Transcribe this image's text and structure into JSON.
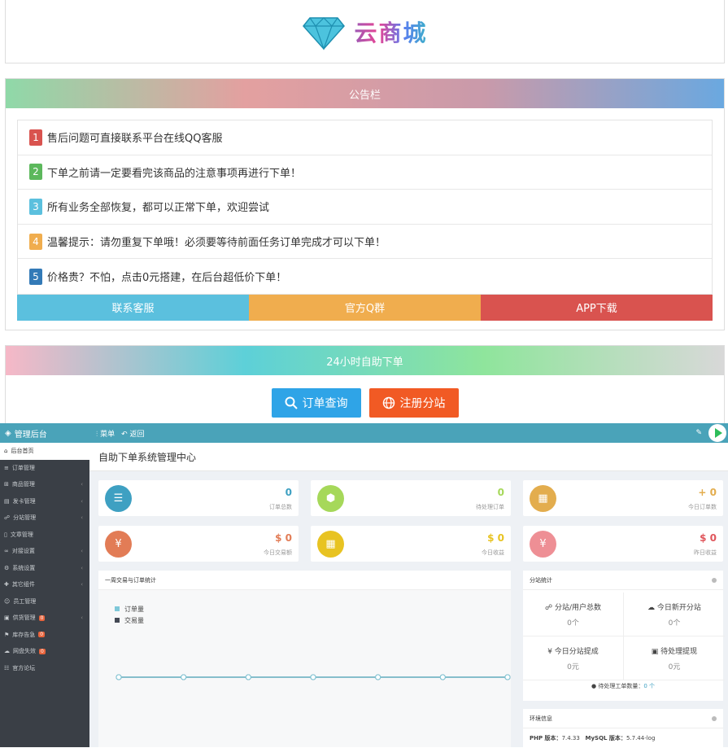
{
  "site": {
    "name": "云商城"
  },
  "notice": {
    "title": "公告栏",
    "items": [
      {
        "num": "1",
        "text": "售后问题可直接联系平台在线QQ客服",
        "color": "#d9534f"
      },
      {
        "num": "2",
        "text": "下单之前请一定要看完该商品的注意事项再进行下单！",
        "color": "#5cb85c"
      },
      {
        "num": "3",
        "text": "所有业务全部恢复，都可以正常下单，欢迎尝试",
        "color": "#5bc0de"
      },
      {
        "num": "4",
        "text": "温馨提示：请勿重复下单哦！必须要等待前面任务订单完成才可以下单！",
        "color": "#f0ad4e"
      },
      {
        "num": "5",
        "text": "价格贵？不怕，点击0元搭建，在后台超低价下单！",
        "color": "#337ab7"
      }
    ],
    "buttons": [
      {
        "label": "联系客服",
        "color": "#5bc0de"
      },
      {
        "label": "官方Q群",
        "color": "#f0ad4e"
      },
      {
        "label": "APP下载",
        "color": "#d9534f"
      }
    ]
  },
  "selfservice": {
    "title": "24小时自助下单",
    "query_label": "订单查询",
    "register_label": "注册分站"
  },
  "admin": {
    "brand": "管理后台",
    "menu_label": "菜单",
    "back_label": "返回",
    "page_title": "自助下单系统管理中心",
    "sidebar": [
      {
        "label": "后台首页",
        "icon": "home-icon",
        "active": true
      },
      {
        "label": "订单管理",
        "icon": "list-icon"
      },
      {
        "label": "商品管理",
        "icon": "cart-icon",
        "arrow": true
      },
      {
        "label": "发卡管理",
        "icon": "card-icon",
        "arrow": true
      },
      {
        "label": "分站管理",
        "icon": "sitemap-icon",
        "arrow": true
      },
      {
        "label": "文章管理",
        "icon": "doc-icon"
      },
      {
        "label": "对接设置",
        "icon": "link-icon",
        "arrow": true
      },
      {
        "label": "系统设置",
        "icon": "gear-icon",
        "arrow": true
      },
      {
        "label": "其它组件",
        "icon": "puzzle-icon",
        "arrow": true
      },
      {
        "label": "员工管理",
        "icon": "user-icon"
      },
      {
        "label": "供货管理",
        "icon": "truck-icon",
        "badge": "0",
        "arrow": true
      },
      {
        "label": "库存告急",
        "icon": "alert-icon",
        "badge": "0"
      },
      {
        "label": "网盘失效",
        "icon": "cloud-icon",
        "badge": "0"
      },
      {
        "label": "官方论坛",
        "icon": "forum-icon"
      }
    ],
    "stats": [
      {
        "value": "0",
        "label": "订单总数",
        "color": "#3ea0c2",
        "valcolor": "#3ea0c2"
      },
      {
        "value": "0",
        "label": "待处理订单",
        "color": "#a6d85a",
        "valcolor": "#a6d85a"
      },
      {
        "value": "+ 0",
        "label": "今日订单数",
        "color": "#e3ad4e",
        "valcolor": "#e3ad4e"
      },
      {
        "value": "$ 0",
        "label": "今日交易额",
        "color": "#e27c56",
        "valcolor": "#e27c56"
      },
      {
        "value": "$ 0",
        "label": "今日收益",
        "color": "#e8c322",
        "valcolor": "#e8c322"
      },
      {
        "value": "$ 0",
        "label": "昨日收益",
        "color": "#ee8f95",
        "valcolor": "#e0565c"
      }
    ],
    "chart_panel": {
      "title": "一周交易与订单统计",
      "legend": [
        "订单量",
        "交易量"
      ]
    },
    "chart_data": {
      "type": "line",
      "series": [
        {
          "name": "订单量",
          "values": [
            0,
            0,
            0,
            0,
            0,
            0,
            0
          ]
        },
        {
          "name": "交易量",
          "values": [
            0,
            0,
            0,
            0,
            0,
            0,
            0
          ]
        }
      ]
    },
    "substation": {
      "title": "分站统计",
      "cells": [
        {
          "label": "分站/用户总数",
          "value": "0个"
        },
        {
          "label": "今日新开分站",
          "value": "0个"
        },
        {
          "label": "¥ 今日分站提成",
          "value": "0元"
        },
        {
          "label": "待处理提现",
          "value": "0元"
        }
      ],
      "pending_label": "待处理工单数量：",
      "pending_value": "0 个"
    },
    "env": {
      "title": "环境信息",
      "php_label": "PHP 版本：",
      "php_value": "7.4.33",
      "mysql_label": "MySQL 版本：",
      "mysql_value": "5.7.44-log"
    }
  }
}
